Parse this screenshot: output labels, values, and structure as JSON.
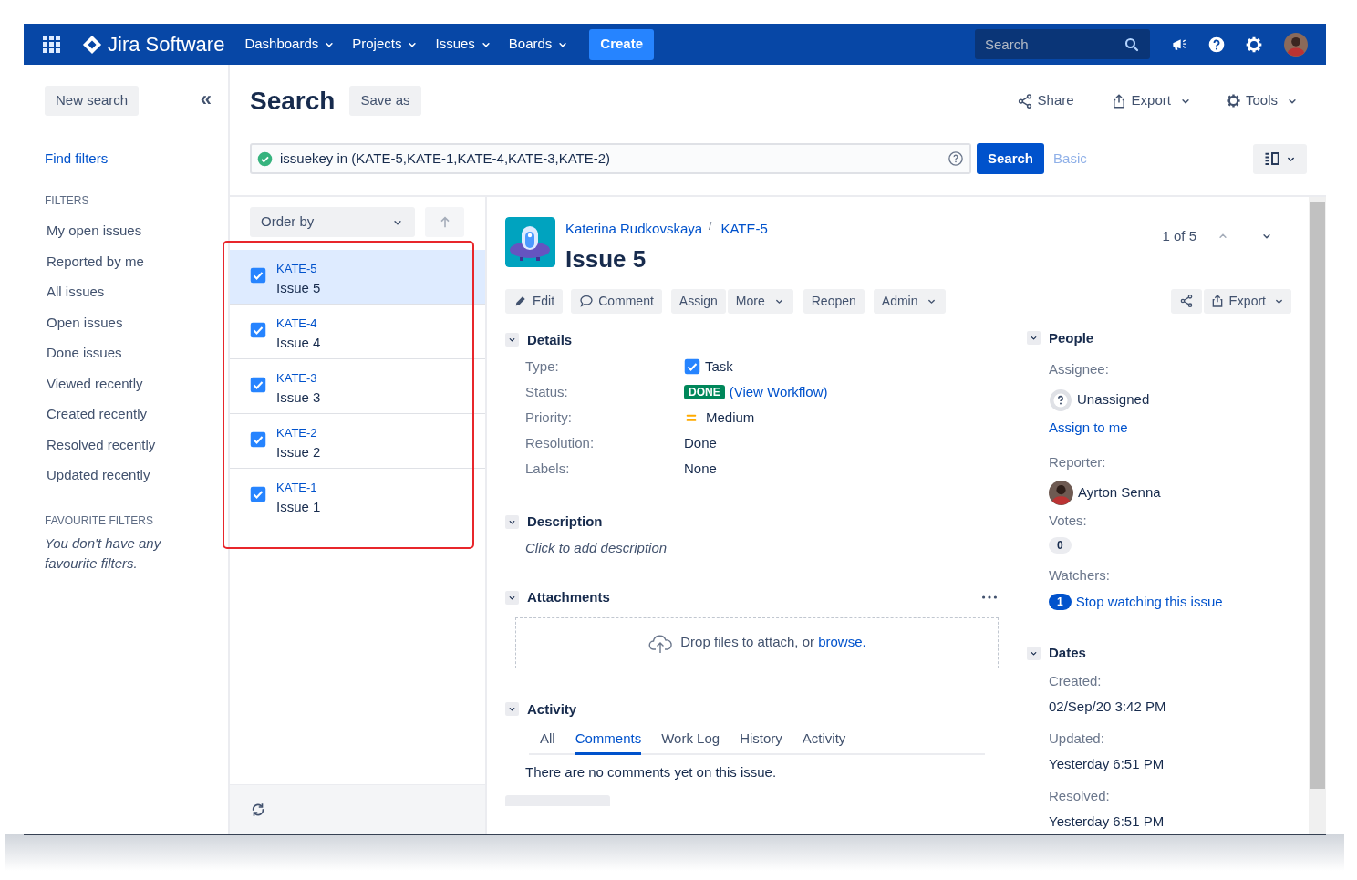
{
  "header": {
    "product": "Jira Software",
    "nav": [
      "Dashboards",
      "Projects",
      "Issues",
      "Boards"
    ],
    "create": "Create",
    "search_placeholder": "Search"
  },
  "sidebar": {
    "new_search": "New search",
    "collapse": "«",
    "find_filters": "Find filters",
    "filters_heading": "FILTERS",
    "filters": [
      "My open issues",
      "Reported by me",
      "All issues",
      "Open issues",
      "Done issues",
      "Viewed recently",
      "Created recently",
      "Resolved recently",
      "Updated recently"
    ],
    "favourites_heading": "FAVOURITE FILTERS",
    "favourites_empty": "You don't have any favourite filters."
  },
  "search": {
    "title": "Search",
    "save_as": "Save as",
    "share": "Share",
    "export": "Export",
    "tools": "Tools",
    "query": "issuekey in (KATE-5,KATE-1,KATE-4,KATE-3,KATE-2)",
    "search_button": "Search",
    "basic": "Basic"
  },
  "issue_list": {
    "order_by": "Order by",
    "items": [
      {
        "key": "KATE-5",
        "summary": "Issue 5",
        "checked": true,
        "selected": true
      },
      {
        "key": "KATE-4",
        "summary": "Issue 4",
        "checked": true,
        "selected": false
      },
      {
        "key": "KATE-3",
        "summary": "Issue 3",
        "checked": true,
        "selected": false
      },
      {
        "key": "KATE-2",
        "summary": "Issue 2",
        "checked": true,
        "selected": false
      },
      {
        "key": "KATE-1",
        "summary": "Issue 1",
        "checked": true,
        "selected": false
      }
    ]
  },
  "issue": {
    "project": "Katerina Rudkovskaya",
    "separator": "/",
    "key": "KATE-5",
    "title": "Issue 5",
    "pager": "1 of 5",
    "actions": [
      "Edit",
      "Comment",
      "Assign",
      "More",
      "Reopen",
      "Admin"
    ],
    "export": "Export",
    "details_heading": "Details",
    "fields": [
      {
        "label": "Type:",
        "value": "Task",
        "kind": "type"
      },
      {
        "label": "Status:",
        "value": "(View Workflow)",
        "badge": "DONE",
        "kind": "status"
      },
      {
        "label": "Priority:",
        "value": "Medium",
        "kind": "priority"
      },
      {
        "label": "Resolution:",
        "value": "Done",
        "kind": "plain"
      },
      {
        "label": "Labels:",
        "value": "None",
        "kind": "plain"
      }
    ],
    "description_heading": "Description",
    "description_placeholder": "Click to add description",
    "attachments_heading": "Attachments",
    "drop_text": "Drop files to attach, or",
    "browse": "browse.",
    "activity_heading": "Activity",
    "activity_tabs": [
      {
        "label": "All",
        "selected": false
      },
      {
        "label": "Comments",
        "selected": true
      },
      {
        "label": "Work Log",
        "selected": false
      },
      {
        "label": "History",
        "selected": false
      },
      {
        "label": "Activity",
        "selected": false
      }
    ],
    "no_comments": "There are no comments yet on this issue.",
    "people_heading": "People",
    "assignee_label": "Assignee:",
    "assignee": "Unassigned",
    "assign_to_me": "Assign to me",
    "reporter_label": "Reporter:",
    "reporter": "Ayrton Senna",
    "votes_label": "Votes:",
    "votes": "0",
    "watchers_label": "Watchers:",
    "watchers": "1",
    "stop_watching": "Stop watching this issue",
    "dates_heading": "Dates",
    "dates": [
      {
        "label": "Created:",
        "value": "02/Sep/20 3:42 PM"
      },
      {
        "label": "Updated:",
        "value": "Yesterday 6:51 PM"
      },
      {
        "label": "Resolved:",
        "value": "Yesterday 6:51 PM"
      }
    ]
  }
}
